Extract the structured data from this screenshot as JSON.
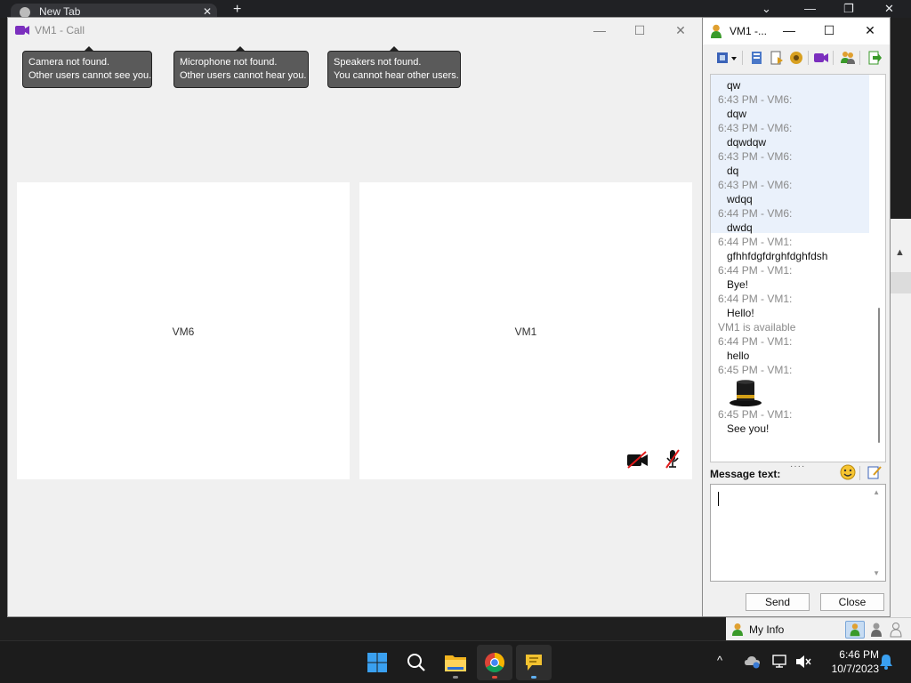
{
  "browser": {
    "tab_title": "New Tab",
    "new_tab_symbol": "+",
    "controls": [
      "⌄",
      "—",
      "❐",
      "✕"
    ]
  },
  "call_window": {
    "title": "VM1 - Call",
    "controls": {
      "minimize": "—",
      "maximize": "☐",
      "close": "✕"
    },
    "tooltips": [
      {
        "line1": "Camera not found.",
        "line2": "Other users cannot see you."
      },
      {
        "line1": "Microphone not found.",
        "line2": "Other users cannot hear you."
      },
      {
        "line1": "Speakers not found.",
        "line2": "You cannot hear other users."
      }
    ],
    "panes": [
      {
        "label": "VM6"
      },
      {
        "label": "VM1"
      }
    ],
    "pane_icons": [
      "camera-off-icon",
      "microphone-off-icon"
    ]
  },
  "chat_window": {
    "title": "VM1 -...",
    "controls": {
      "minimize": "—",
      "maximize": "☐",
      "close": "✕"
    },
    "toolbar_icons": [
      "status-dropdown-icon",
      "history-icon",
      "file-transfer-icon",
      "settings-icon",
      "video-call-icon",
      "add-contact-icon",
      "exit-icon"
    ],
    "messages": [
      {
        "kind": "text",
        "value": "qw"
      },
      {
        "kind": "head",
        "value": "6:43 PM - VM6:"
      },
      {
        "kind": "text",
        "value": "dqw"
      },
      {
        "kind": "head",
        "value": "6:43 PM - VM6:"
      },
      {
        "kind": "text",
        "value": "dqwdqw"
      },
      {
        "kind": "head",
        "value": "6:43 PM - VM6:"
      },
      {
        "kind": "text",
        "value": "dq"
      },
      {
        "kind": "head",
        "value": "6:43 PM - VM6:"
      },
      {
        "kind": "text",
        "value": "wdqq"
      },
      {
        "kind": "head",
        "value": "6:44 PM - VM6:"
      },
      {
        "kind": "text",
        "value": "dwdq"
      },
      {
        "kind": "head",
        "value": "6:44 PM - VM1:"
      },
      {
        "kind": "text",
        "value": "gfhhfdgfdrghfdghfdsh"
      },
      {
        "kind": "head",
        "value": "6:44 PM - VM1:"
      },
      {
        "kind": "text",
        "value": "Bye!"
      },
      {
        "kind": "head",
        "value": "6:44 PM - VM1:"
      },
      {
        "kind": "text",
        "value": "Hello!"
      },
      {
        "kind": "head",
        "value": "VM1 is available"
      },
      {
        "kind": "head",
        "value": "6:44 PM - VM1:"
      },
      {
        "kind": "text",
        "value": "hello"
      },
      {
        "kind": "head",
        "value": "6:45 PM - VM1:"
      },
      {
        "kind": "emoji",
        "value": "top-hat-icon"
      },
      {
        "kind": "head",
        "value": "6:45 PM - VM1:"
      },
      {
        "kind": "text",
        "value": "See you!"
      }
    ],
    "splitter": "····",
    "message_label": "Message text:",
    "message_value": "",
    "buttons": {
      "send": "Send",
      "close": "Close"
    }
  },
  "status_strip": {
    "my_info": "My Info"
  },
  "taskbar": {
    "apps": [
      "windows-start-icon",
      "search-icon",
      "file-explorer-icon",
      "chrome-icon",
      "messenger-icon"
    ],
    "clock_time": "6:46 PM",
    "clock_date": "10/7/2023"
  },
  "colors": {
    "accent_purple": "#7b2fbe",
    "tooltip_bg": "#5a5a5a",
    "highlight": "#eaf1fb",
    "taskbar": "#1c1c1c"
  }
}
